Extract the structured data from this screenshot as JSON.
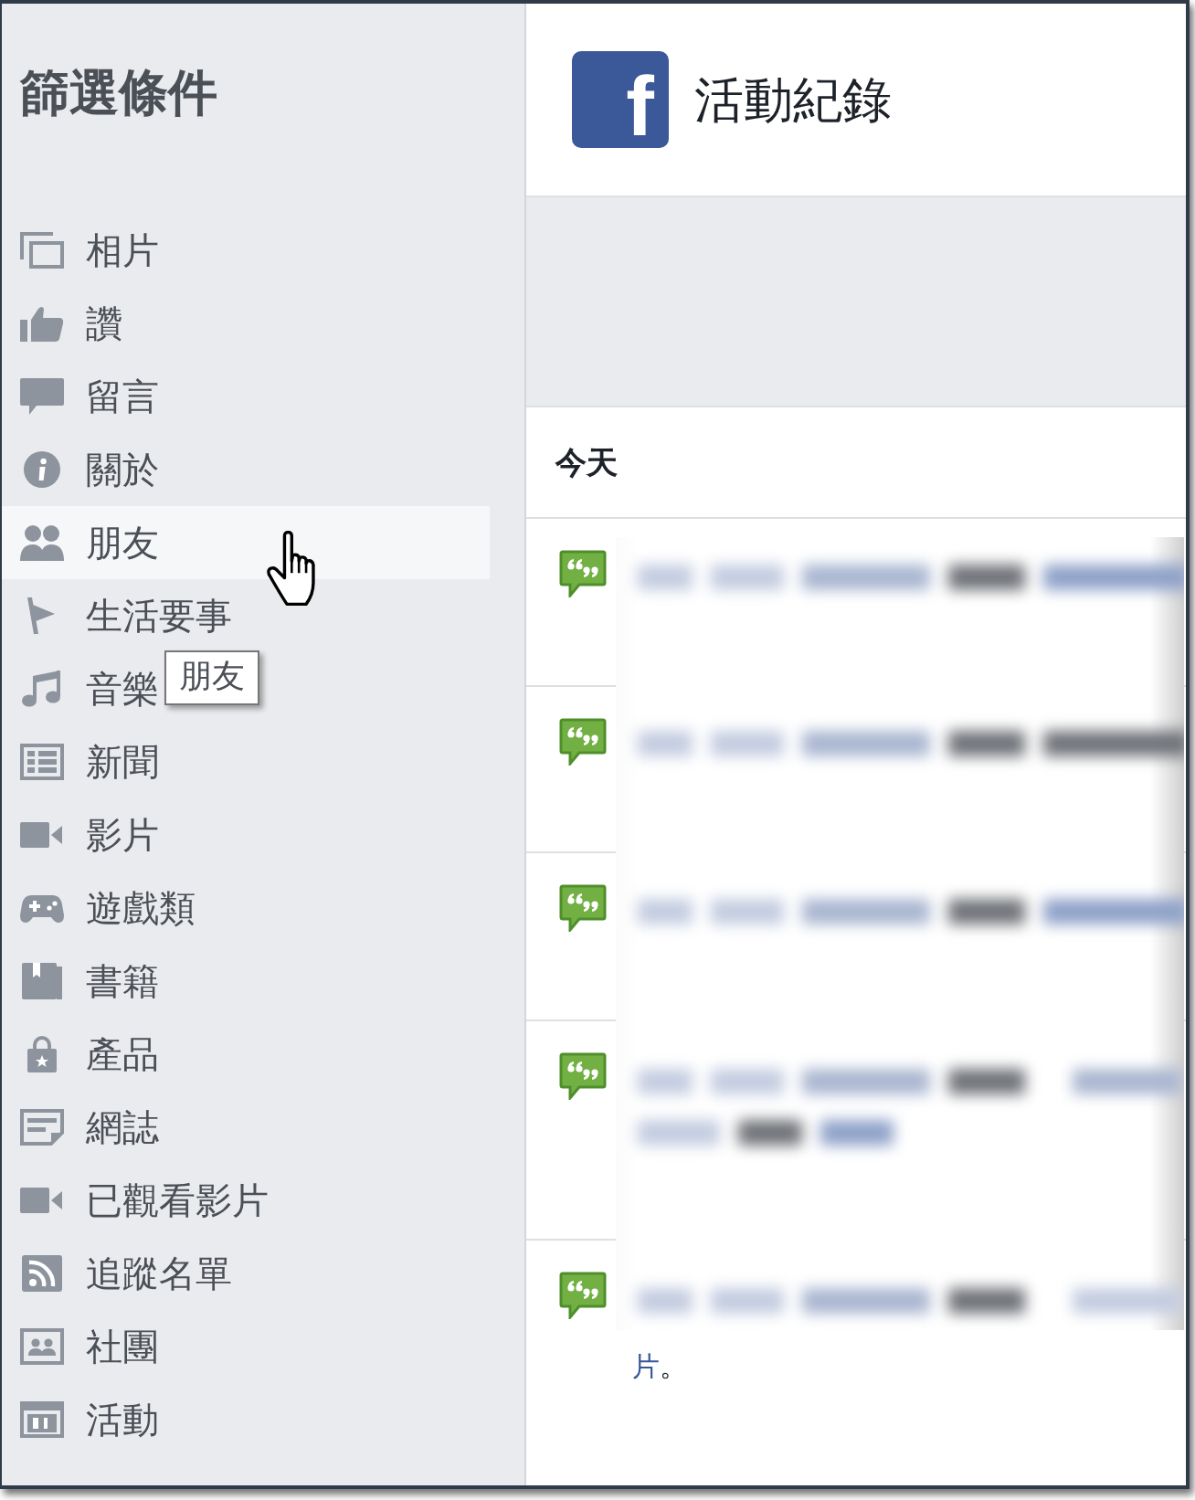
{
  "sidebar": {
    "title": "篩選條件",
    "items": [
      {
        "label": "相片",
        "hovered": false
      },
      {
        "label": "讚",
        "hovered": false
      },
      {
        "label": "留言",
        "hovered": false
      },
      {
        "label": "關於",
        "hovered": false
      },
      {
        "label": "朋友",
        "hovered": true
      },
      {
        "label": "生活要事",
        "hovered": false
      },
      {
        "label": "音樂",
        "hovered": false
      },
      {
        "label": "新聞",
        "hovered": false
      },
      {
        "label": "影片",
        "hovered": false
      },
      {
        "label": "遊戲類",
        "hovered": false
      },
      {
        "label": "書籍",
        "hovered": false
      },
      {
        "label": "產品",
        "hovered": false
      },
      {
        "label": "網誌",
        "hovered": false
      },
      {
        "label": "已觀看影片",
        "hovered": false
      },
      {
        "label": "追蹤名單",
        "hovered": false
      },
      {
        "label": "社團",
        "hovered": false
      },
      {
        "label": "活動",
        "hovered": false
      }
    ],
    "tooltip": {
      "text": "朋友"
    }
  },
  "header": {
    "logo_letter": "f",
    "title": "活動紀錄"
  },
  "activity": {
    "heading": "今天",
    "entries": [
      {
        "kind": "comment"
      },
      {
        "kind": "comment"
      },
      {
        "kind": "comment"
      },
      {
        "kind": "comment"
      },
      {
        "kind": "comment",
        "visible_text": [
          {
            "kind": "link",
            "text": "片"
          },
          {
            "kind": "plain",
            "text": "。"
          }
        ]
      }
    ]
  }
}
